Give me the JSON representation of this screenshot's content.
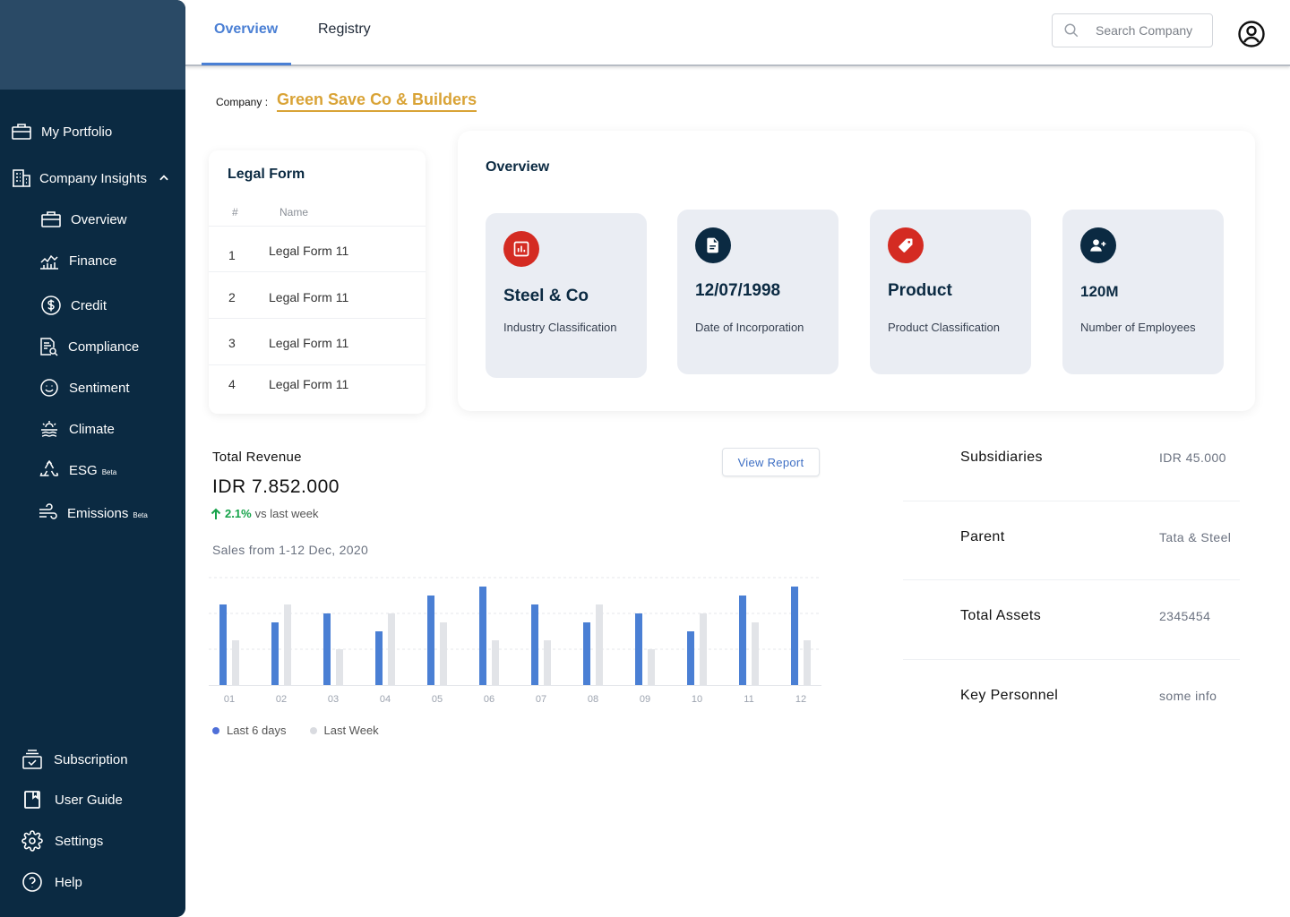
{
  "sidebar": {
    "items": [
      {
        "label": "My Portfolio"
      },
      {
        "label": "Company Insights"
      },
      {
        "label": "Overview"
      },
      {
        "label": "Finance"
      },
      {
        "label": "Credit"
      },
      {
        "label": "Compliance"
      },
      {
        "label": "Sentiment"
      },
      {
        "label": "Climate"
      },
      {
        "label": "ESG",
        "badge": "Beta"
      },
      {
        "label": "Emissions",
        "badge": "Beta"
      }
    ],
    "bottom": [
      {
        "label": "Subscription"
      },
      {
        "label": "User Guide"
      },
      {
        "label": "Settings"
      },
      {
        "label": "Help"
      }
    ]
  },
  "header": {
    "tabs": [
      {
        "label": "Overview"
      },
      {
        "label": "Registry"
      }
    ],
    "search_placeholder": "Search Company"
  },
  "company": {
    "label": "Company :",
    "name": "Green Save Co & Builders"
  },
  "legal_form": {
    "title": "Legal Form",
    "columns": [
      "#",
      "Name"
    ],
    "rows": [
      {
        "num": "1",
        "name": "Legal Form 11"
      },
      {
        "num": "2",
        "name": "Legal Form 11"
      },
      {
        "num": "3",
        "name": "Legal Form 11"
      },
      {
        "num": "4",
        "name": "Legal Form 11"
      }
    ]
  },
  "overview": {
    "title": "Overview",
    "tiles": [
      {
        "value": "Steel & Co",
        "label": "Industry Classification",
        "icon": "chart-icon",
        "color": "#d42b22"
      },
      {
        "value": "12/07/1998",
        "label": "Date of Incorporation",
        "icon": "document-icon",
        "color": "#0b2a42"
      },
      {
        "value": "Product",
        "label": "Product Classification",
        "icon": "tag-icon",
        "color": "#d42b22"
      },
      {
        "value": "120M",
        "label": "Number of Employees",
        "icon": "add-user-icon",
        "color": "#0b2a42"
      }
    ]
  },
  "revenue": {
    "title": "Total Revenue",
    "value": "IDR 7.852.000",
    "change_pct": "2.1%",
    "change_text": "vs last week",
    "subtitle": "Sales from 1-12 Dec, 2020",
    "view_report": "View Report"
  },
  "chart_data": {
    "type": "bar",
    "categories": [
      "01",
      "02",
      "03",
      "04",
      "05",
      "06",
      "07",
      "08",
      "09",
      "10",
      "11",
      "12"
    ],
    "series": [
      {
        "name": "Last 6 days",
        "color": "#4a7fd4",
        "values": [
          90,
          70,
          80,
          60,
          100,
          110,
          90,
          70,
          80,
          60,
          100,
          110
        ]
      },
      {
        "name": "Last Week",
        "color": "#e2e4e8",
        "values": [
          50,
          90,
          40,
          80,
          70,
          50,
          50,
          90,
          40,
          80,
          70,
          50
        ]
      }
    ],
    "ylim": [
      0,
      120
    ],
    "grid": true,
    "legend": "bottom-left"
  },
  "info": [
    {
      "key": "Subsidiaries",
      "value": "IDR 45.000"
    },
    {
      "key": "Parent",
      "value": "Tata & Steel"
    },
    {
      "key": "Total Assets",
      "value": "2345454"
    },
    {
      "key": "Key Personnel",
      "value": "some info"
    }
  ]
}
